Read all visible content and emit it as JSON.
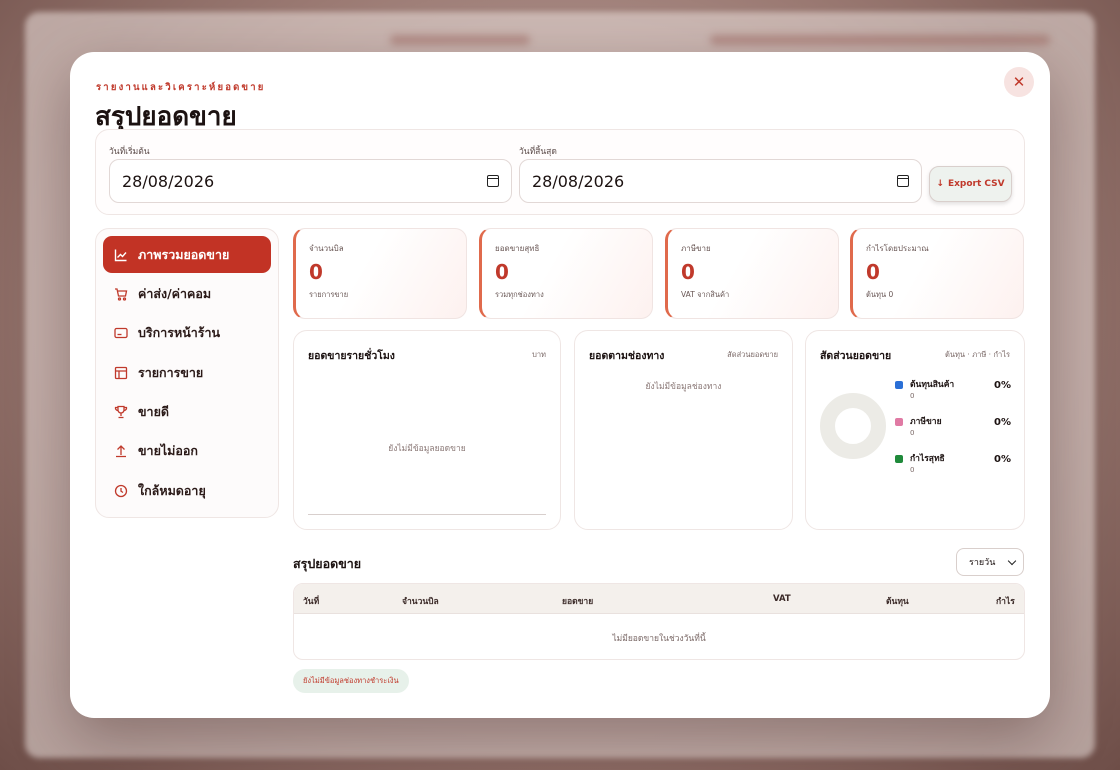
{
  "modal": {
    "eyebrow": "รายงานและวิเคราะห์ยอดขาย",
    "title": "สรุปยอดขาย",
    "close_label": "✕"
  },
  "filters": {
    "start_label": "วันที่เริ่มต้น",
    "start_value": "28/08/2026",
    "end_label": "วันที่สิ้นสุด",
    "end_value": "28/08/2026",
    "export_label": "Export CSV",
    "export_icon": "↓"
  },
  "sidebar": {
    "items": [
      {
        "label": "ภาพรวมยอดขาย",
        "icon": "chart-line-icon",
        "active": true
      },
      {
        "label": "ค่าส่ง/ค่าคอม",
        "icon": "cart-icon",
        "active": false
      },
      {
        "label": "บริการหน้าร้าน",
        "icon": "card-icon",
        "active": false
      },
      {
        "label": "รายการขาย",
        "icon": "table-icon",
        "active": false
      },
      {
        "label": "ขายดี",
        "icon": "trophy-icon",
        "active": false
      },
      {
        "label": "ขายไม่ออก",
        "icon": "upload-icon",
        "active": false
      },
      {
        "label": "ใกล้หมดอายุ",
        "icon": "clock-icon",
        "active": false
      }
    ]
  },
  "stats": [
    {
      "label": "จำนวนบิล",
      "value": "0",
      "sub": "รายการขาย"
    },
    {
      "label": "ยอดขายสุทธิ",
      "value": "0",
      "sub": "รวมทุกช่องทาง"
    },
    {
      "label": "ภาษีขาย",
      "value": "0",
      "sub": "VAT จากสินค้า"
    },
    {
      "label": "กำไรโดยประมาณ",
      "value": "0",
      "sub": "ต้นทุน 0"
    }
  ],
  "panels": {
    "hourly": {
      "title": "ยอดขายรายชั่วโมง",
      "note": "บาท",
      "empty": "ยังไม่มีข้อมูลยอดขาย"
    },
    "channel": {
      "title": "ยอดตามช่องทาง",
      "note": "สัดส่วนยอดขาย",
      "empty": "ยังไม่มีข้อมูลช่องทาง"
    },
    "share": {
      "title": "สัดส่วนยอดขาย",
      "note": "ต้นทุน · ภาษี · กำไร",
      "legend": [
        {
          "name": "ต้นทุนสินค้า",
          "value": "0",
          "pct": "0%",
          "color": "#2a6fd6"
        },
        {
          "name": "ภาษีขาย",
          "value": "0",
          "pct": "0%",
          "color": "#e07aa4"
        },
        {
          "name": "กำไรสุทธิ",
          "value": "0",
          "pct": "0%",
          "color": "#1f8a3a"
        }
      ]
    }
  },
  "summary": {
    "title": "สรุปยอดขาย",
    "period": "รายวัน",
    "columns": [
      "วันที่",
      "จำนวนบิล",
      "ยอดขาย",
      "VAT",
      "ต้นทุน",
      "กำไร"
    ],
    "empty": "ไม่มียอดขายในช่วงวันที่นี้"
  },
  "payment_pill": "ยังไม่มีข้อมูลช่องทางชำระเงิน",
  "colors": {
    "accent": "#c23325",
    "accent_soft": "#f7e3e1"
  }
}
